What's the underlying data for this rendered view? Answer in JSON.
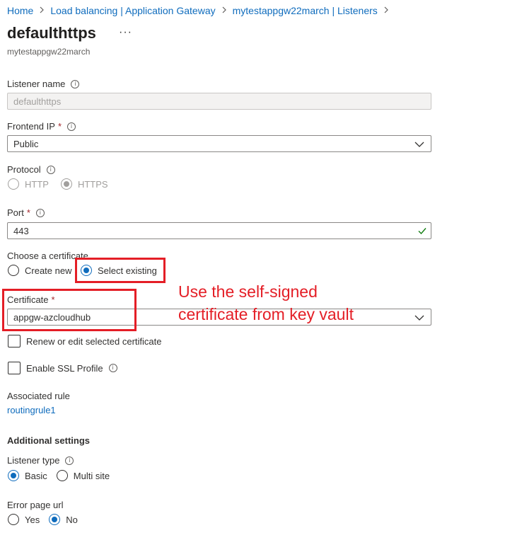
{
  "breadcrumb": {
    "items": [
      "Home",
      "Load balancing | Application Gateway",
      "mytestappgw22march | Listeners"
    ]
  },
  "header": {
    "title": "defaulthttps",
    "more": "···",
    "subtitle": "mytestappgw22march"
  },
  "form": {
    "listener_name": {
      "label": "Listener name",
      "value": "defaulthttps"
    },
    "frontend_ip": {
      "label": "Frontend IP",
      "required": "*",
      "value": "Public"
    },
    "protocol": {
      "label": "Protocol",
      "options": [
        "HTTP",
        "HTTPS"
      ],
      "selected": "HTTPS"
    },
    "port": {
      "label": "Port",
      "required": "*",
      "value": "443"
    },
    "choose_certificate": {
      "label": "Choose a certificate",
      "options": [
        "Create new",
        "Select existing"
      ],
      "selected": "Select existing"
    },
    "certificate": {
      "label": "Certificate",
      "required": "*",
      "value": "appgw-azcloudhub"
    },
    "renew_checkbox": {
      "label": "Renew or edit selected certificate",
      "checked": false
    },
    "ssl_profile_checkbox": {
      "label": "Enable SSL Profile",
      "checked": false
    },
    "associated_rule": {
      "label": "Associated rule",
      "value": "routingrule1"
    },
    "additional_settings": {
      "title": "Additional settings"
    },
    "listener_type": {
      "label": "Listener type",
      "options": [
        "Basic",
        "Multi site"
      ],
      "selected": "Basic"
    },
    "error_page_url": {
      "label": "Error page url",
      "options": [
        "Yes",
        "No"
      ],
      "selected": "No"
    }
  },
  "annotation": {
    "line1": "Use the self-signed",
    "line2": "certificate from key vault",
    "color": "#e41e26"
  },
  "colors": {
    "accent": "#0f6cbd",
    "valid_check": "#107c10",
    "required": "#a4262c"
  },
  "icons": {
    "info": "info-icon",
    "chevron": "chevron-down-icon",
    "breadcrumb_sep": "chevron-right-icon",
    "valid": "checkmark-icon",
    "more": "more-icon"
  }
}
